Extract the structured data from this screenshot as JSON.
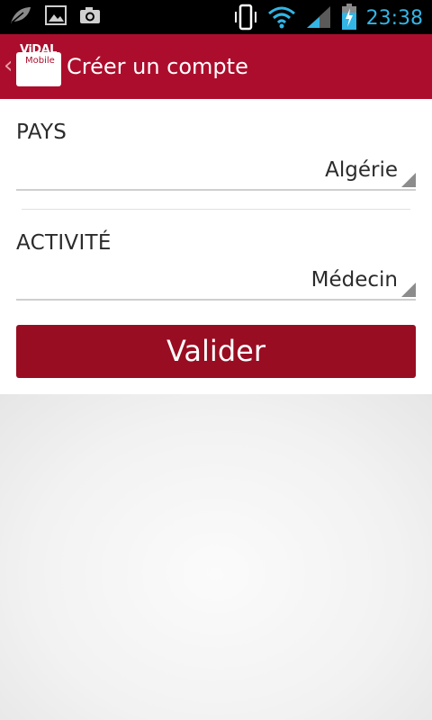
{
  "status_bar": {
    "time": "23:38",
    "left_icons": [
      "leaf-icon",
      "gallery-icon",
      "camera-icon"
    ],
    "right_icons": [
      "vibrate-icon",
      "wifi-icon",
      "signal-icon",
      "battery-charging-icon"
    ],
    "accent_color": "#33b5e5"
  },
  "action_bar": {
    "logo_line1": "ViDAL",
    "logo_line2": "Mobile",
    "title": "Créer un compte",
    "color": "#ad0d2c"
  },
  "form": {
    "country_label": "PAYS",
    "country_value": "Algérie",
    "activity_label": "ACTIVITÉ",
    "activity_value": "Médecin",
    "submit_label": "Valider",
    "submit_color": "#980d22"
  }
}
